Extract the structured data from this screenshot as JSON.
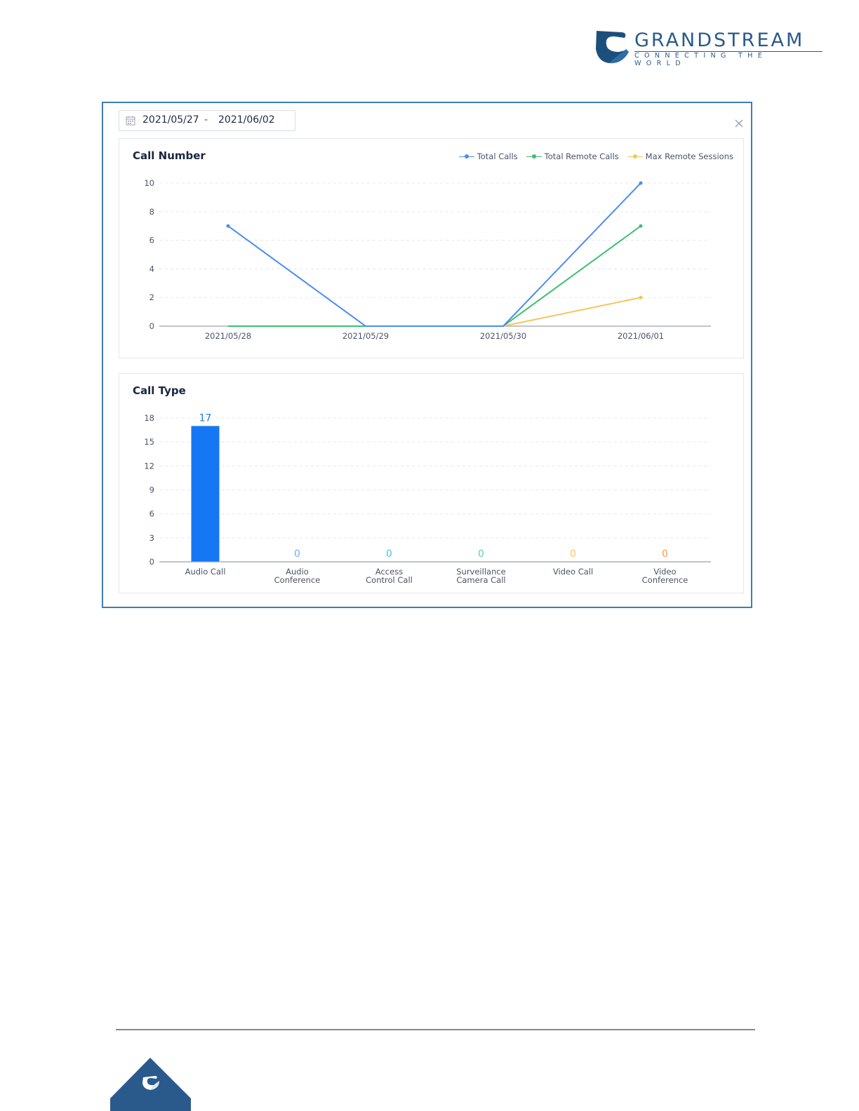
{
  "brand": {
    "name": "GRANDSTREAM",
    "tagline": "CONNECTING THE WORLD",
    "color": "#2a5a8c",
    "logo_icon": "grandstream-logo-icon"
  },
  "date_range": {
    "start": "2021/05/27",
    "separator": "-",
    "end": "2021/06/02",
    "icon": "calendar-icon"
  },
  "close_icon": "close-icon",
  "call_number": {
    "title": "Call Number",
    "legend": [
      {
        "label": "Total Calls",
        "color": "#4a8ef0"
      },
      {
        "label": "Total Remote Calls",
        "color": "#3dbf73"
      },
      {
        "label": "Max Remote Sessions",
        "color": "#f5c55a"
      }
    ]
  },
  "call_type": {
    "title": "Call Type"
  },
  "chart_data": [
    {
      "type": "line",
      "title": "Call Number",
      "x": [
        "2021/05/28",
        "2021/05/29",
        "2021/05/30",
        "2021/06/01"
      ],
      "ylim": [
        0,
        10
      ],
      "yticks": [
        0,
        2,
        4,
        6,
        8,
        10
      ],
      "grid": true,
      "legend": "top-right",
      "series": [
        {
          "name": "Total Calls",
          "values": [
            7,
            0,
            0,
            10
          ],
          "color": "#4a8ef0"
        },
        {
          "name": "Total Remote Calls",
          "values": [
            0,
            0,
            0,
            7
          ],
          "color": "#3dbf73"
        },
        {
          "name": "Max Remote Sessions",
          "values": [
            0,
            0,
            0,
            2
          ],
          "color": "#f5c55a"
        }
      ]
    },
    {
      "type": "bar",
      "title": "Call Type",
      "categories": [
        [
          "Audio Call"
        ],
        [
          "Audio",
          "Conference"
        ],
        [
          "Access",
          "Control Call"
        ],
        [
          "Surveillance",
          "Camera Call"
        ],
        [
          "Video Call"
        ],
        [
          "Video",
          "Conference"
        ]
      ],
      "values": [
        17,
        0,
        0,
        0,
        0,
        0
      ],
      "label_colors": [
        "#1e7be6",
        "#6ab0f5",
        "#52c1e8",
        "#5fd1a8",
        "#f5c55a",
        "#f59a45"
      ],
      "bar_color": "#1677f5",
      "ylim": [
        0,
        18
      ],
      "yticks": [
        0,
        3,
        6,
        9,
        12,
        15,
        18
      ],
      "grid": true
    }
  ]
}
